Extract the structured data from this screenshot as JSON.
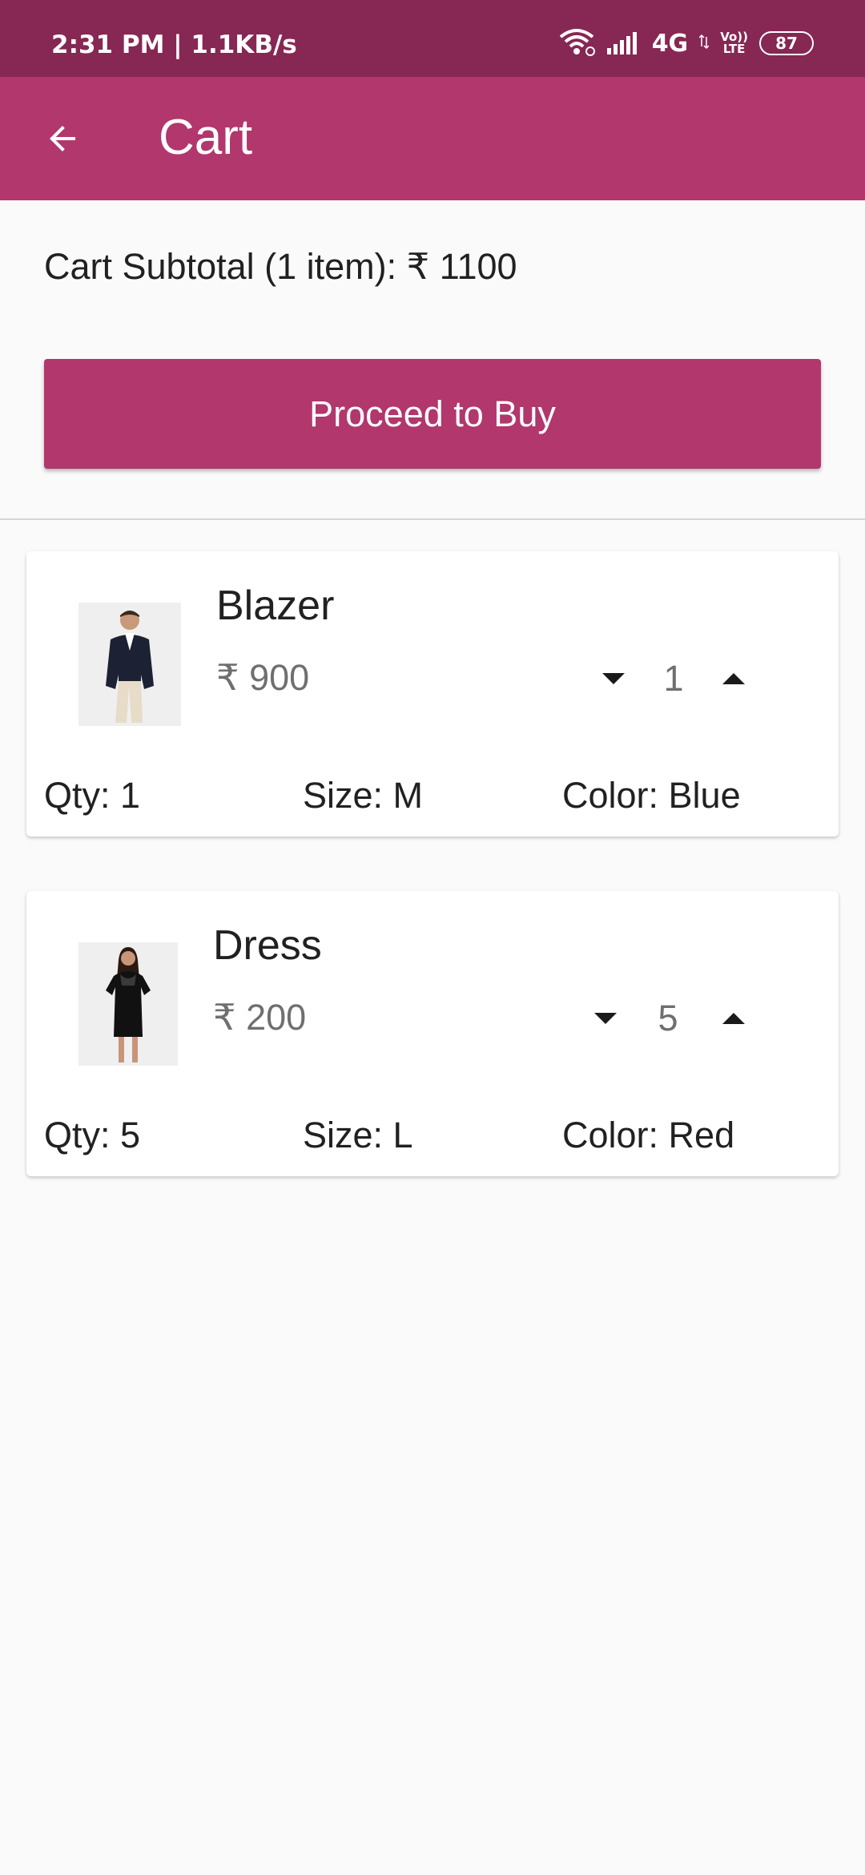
{
  "status_bar": {
    "time": "2:31 PM | 1.1KB/s",
    "network": "4G",
    "volte_top": "Vo))",
    "volte_bottom": "LTE",
    "battery": "87"
  },
  "app_bar": {
    "title": "Cart",
    "back_icon": "arrow-back-icon"
  },
  "cart": {
    "subtotal_text": "Cart Subtotal (1 item): ₹ 1100",
    "proceed_label": "Proceed to Buy",
    "items": [
      {
        "name": "Blazer",
        "price": "₹ 900",
        "qty": "1",
        "qty_label": "Qty: 1",
        "size_label": "Size: M",
        "color_label": "Color: Blue"
      },
      {
        "name": "Dress",
        "price": "₹ 200",
        "qty": "5",
        "qty_label": "Qty: 5",
        "size_label": "Size: L",
        "color_label": "Color: Red"
      }
    ]
  },
  "colors": {
    "status_bar": "#872753",
    "primary": "#b1376d",
    "background": "#fafafa",
    "card": "#ffffff",
    "text_primary": "#212121",
    "text_secondary": "#6f6f6f"
  }
}
